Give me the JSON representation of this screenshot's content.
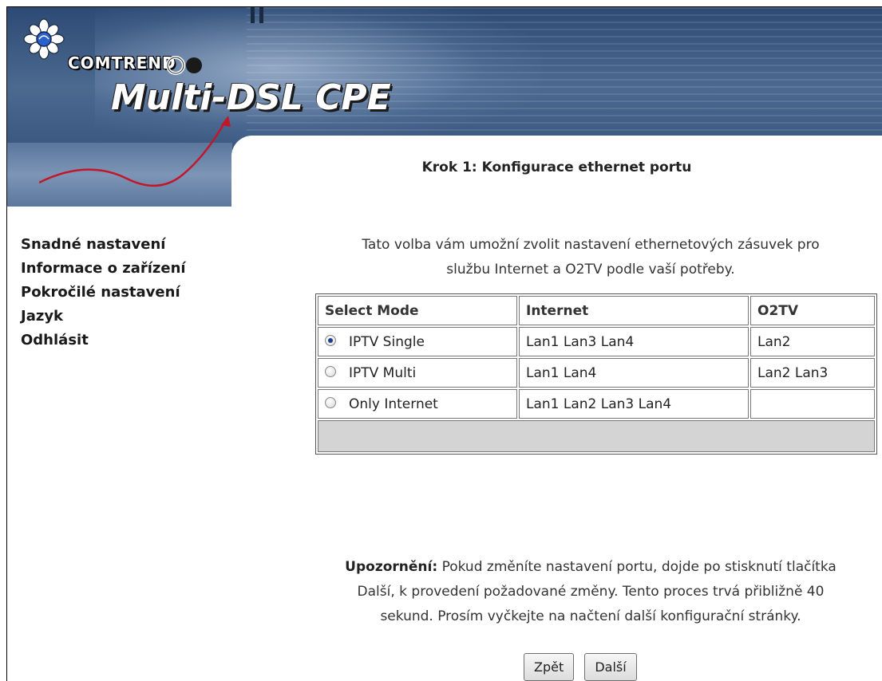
{
  "header": {
    "brand": "COMTREND",
    "product": "Multi-DSL CPE"
  },
  "sidebar": {
    "items": [
      {
        "label": "Snadné nastavení"
      },
      {
        "label": "Informace o zařízení"
      },
      {
        "label": "Pokročilé nastavení"
      },
      {
        "label": "Jazyk"
      },
      {
        "label": "Odhlásit"
      }
    ]
  },
  "main": {
    "title": "Krok 1: Konfigurace ethernet portu",
    "intro_line1": "Tato volba vám umožní zvolit nastavení ethernetových zásuvek pro",
    "intro_line2": "službu Internet a O2TV podle vaší potřeby.",
    "table": {
      "headers": [
        "Select Mode",
        "Internet",
        "O2TV"
      ],
      "rows": [
        {
          "mode": "IPTV Single",
          "internet": "Lan1 Lan3 Lan4",
          "o2tv": "Lan2",
          "selected": true
        },
        {
          "mode": "IPTV Multi",
          "internet": "Lan1 Lan4",
          "o2tv": "Lan2 Lan3",
          "selected": false
        },
        {
          "mode": "Only Internet",
          "internet": "Lan1 Lan2 Lan3 Lan4",
          "o2tv": "",
          "selected": false
        }
      ]
    },
    "warning_label": "Upozornění:",
    "warning_line1": "Pokud změníte nastavení portu, dojde po stisknutí tlačítka",
    "warning_line2": "Další, k provedení požadované změny. Tento proces trvá přibližně 40",
    "warning_line3": "sekund. Prosím vyčkejte na načtení další konfigurační stránky.",
    "back_button": "Zpět",
    "next_button": "Další"
  },
  "colors": {
    "banner": "#3a5880",
    "selected_radio": "#1a3d8f",
    "table_footer": "#d4d4d4"
  }
}
